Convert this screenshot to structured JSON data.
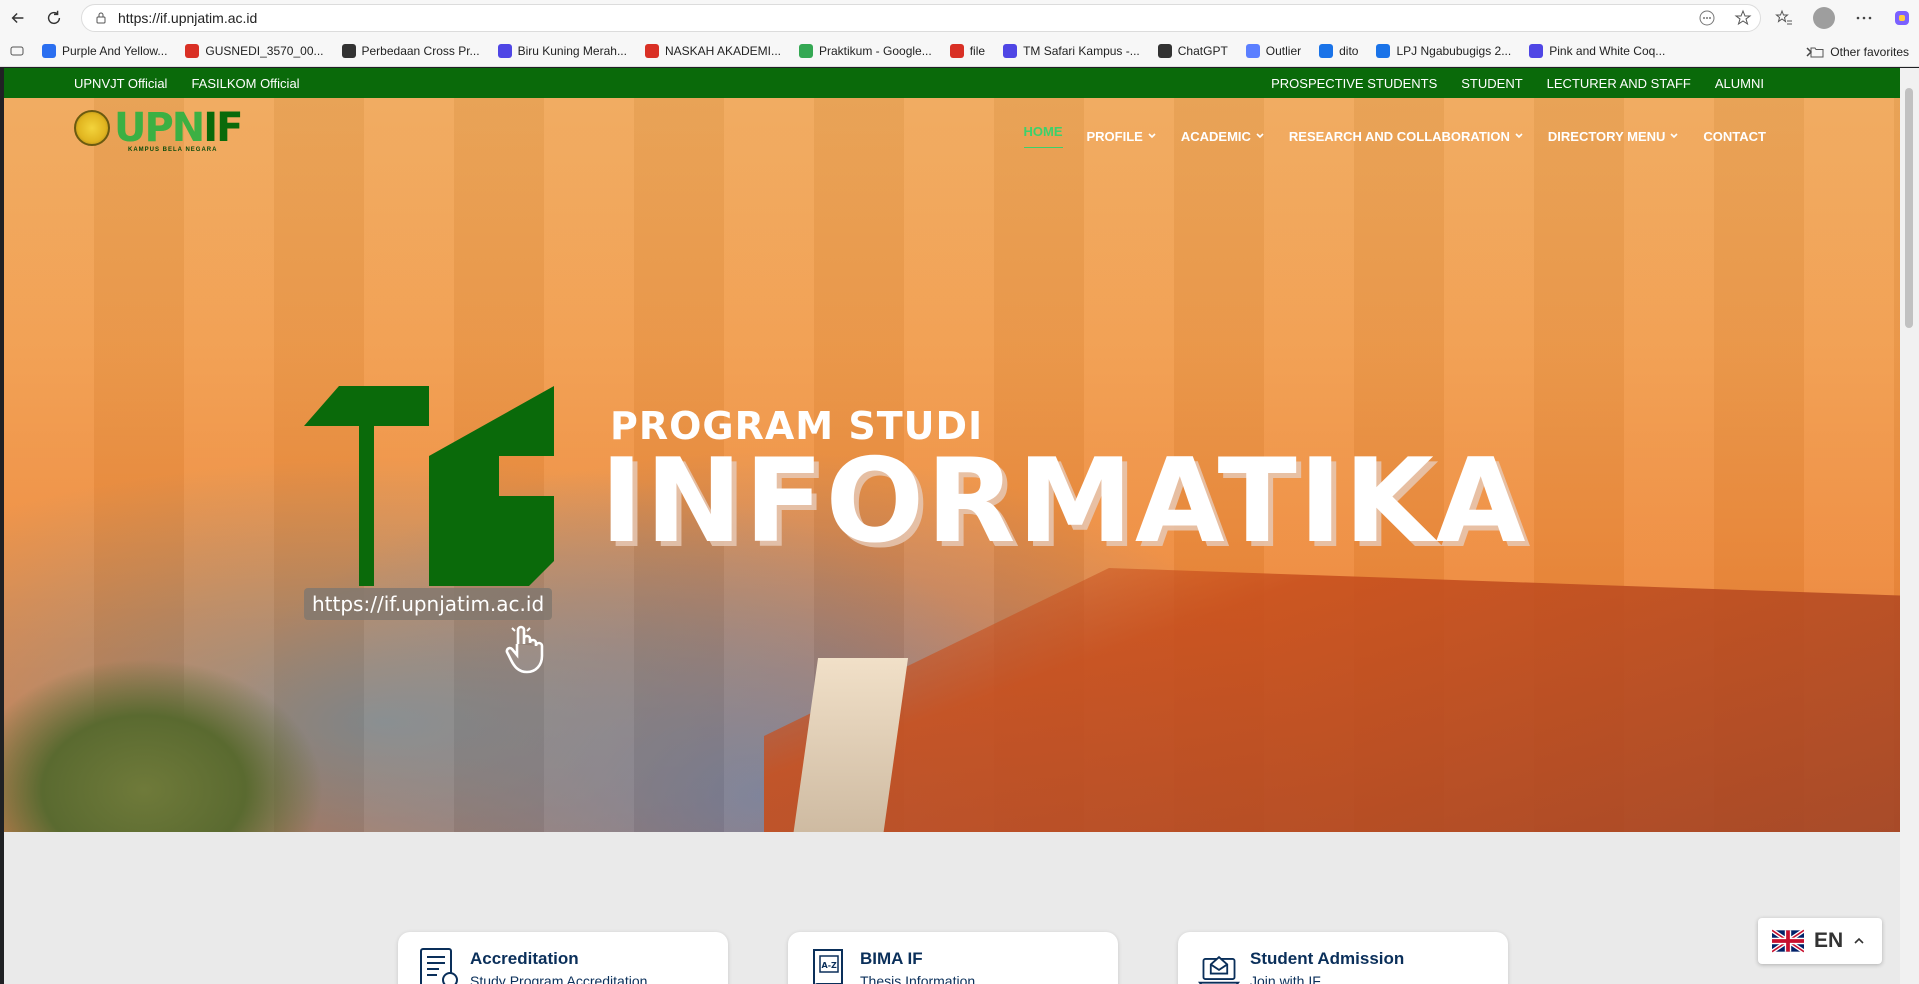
{
  "browser": {
    "url": "https://if.upnjatim.ac.id",
    "bookmarks": [
      {
        "label": "Purple And Yellow...",
        "color": "#2b6ff0"
      },
      {
        "label": "GUSNEDI_3570_00...",
        "color": "#d93025"
      },
      {
        "label": "Perbedaan Cross Pr...",
        "color": "#333333"
      },
      {
        "label": "Biru Kuning Merah...",
        "color": "#4f46e5"
      },
      {
        "label": "NASKAH AKADEMI...",
        "color": "#d93025"
      },
      {
        "label": "Praktikum - Google...",
        "color": "#34a853"
      },
      {
        "label": "file",
        "color": "#d93025"
      },
      {
        "label": "TM Safari Kampus -...",
        "color": "#4f46e5"
      },
      {
        "label": "ChatGPT",
        "color": "#333333"
      },
      {
        "label": "Outlier",
        "color": "#5b7fff"
      },
      {
        "label": "dito",
        "color": "#1a73e8"
      },
      {
        "label": "LPJ Ngabubugigs 2...",
        "color": "#1a73e8"
      },
      {
        "label": "Pink and White Coq...",
        "color": "#4f46e5"
      }
    ],
    "other_favorites": "Other favorites"
  },
  "topbar": {
    "left": [
      "UPNVJT Official",
      "FASILKOM Official"
    ],
    "right": [
      "PROSPECTIVE STUDENTS",
      "STUDENT",
      "LECTURER AND STAFF",
      "ALUMNI"
    ]
  },
  "logo": {
    "word_light": "UPN",
    "word_dark": "IF",
    "tagline": "KAMPUS BELA NEGARA"
  },
  "menu": [
    {
      "label": "HOME",
      "active": true,
      "dropdown": false
    },
    {
      "label": "PROFILE",
      "active": false,
      "dropdown": true
    },
    {
      "label": "ACADEMIC",
      "active": false,
      "dropdown": true
    },
    {
      "label": "RESEARCH AND COLLABORATION",
      "active": false,
      "dropdown": true
    },
    {
      "label": "DIRECTORY MENU",
      "active": false,
      "dropdown": true
    },
    {
      "label": "CONTACT",
      "active": false,
      "dropdown": false
    }
  ],
  "hero": {
    "subtitle": "PROGRAM STUDI",
    "title": "INFORMATIKA",
    "tooltip": "https://if.upnjatim.ac.id"
  },
  "cards": [
    {
      "title": "Accreditation",
      "desc": "Study Program Accreditation",
      "icon": "certificate-icon"
    },
    {
      "title": "BIMA IF",
      "desc": "Thesis Information",
      "icon": "book-az-icon"
    },
    {
      "title": "Student Admission",
      "desc": "Join with IF",
      "icon": "laptop-mail-icon"
    }
  ],
  "language": {
    "code": "EN"
  },
  "colors": {
    "brand_green": "#0a6a0a",
    "accent_green": "#3cb043",
    "active_menu": "#3cd16b",
    "card_text": "#0a2f5a"
  }
}
